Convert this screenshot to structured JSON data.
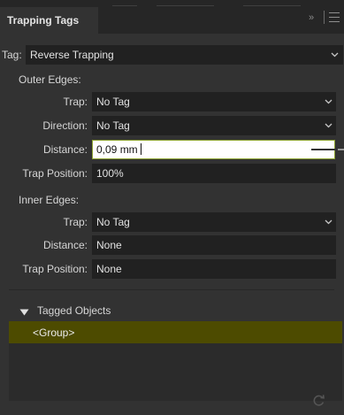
{
  "panel": {
    "title": "Trapping Tags",
    "collapse_glyph": "»",
    "icons": [
      "double-chevron-right-icon",
      "hamburger-menu-icon",
      "refresh-icon",
      "disclosure-triangle-icon",
      "chevron-down-icon"
    ]
  },
  "tag": {
    "label": "Tag:",
    "value": "Reverse Trapping"
  },
  "outer": {
    "heading": "Outer Edges:",
    "trap": {
      "label": "Trap:",
      "value": "No Tag"
    },
    "direction": {
      "label": "Direction:",
      "value": "No Tag"
    },
    "distance": {
      "label": "Distance:",
      "value": "0,09 mm"
    },
    "position": {
      "label": "Trap Position:",
      "value": "100%"
    }
  },
  "inner": {
    "heading": "Inner Edges:",
    "trap": {
      "label": "Trap:",
      "value": "No Tag"
    },
    "distance": {
      "label": "Distance:",
      "value": "None"
    },
    "position": {
      "label": "Trap Position:",
      "value": "None"
    }
  },
  "tagged": {
    "heading": "Tagged Objects",
    "items": [
      "<Group>"
    ]
  },
  "colors": {
    "panel_bg": "#323232",
    "field_bg": "#212121",
    "selection_row": "#4d4b00",
    "focus_border": "#8aa12e"
  }
}
